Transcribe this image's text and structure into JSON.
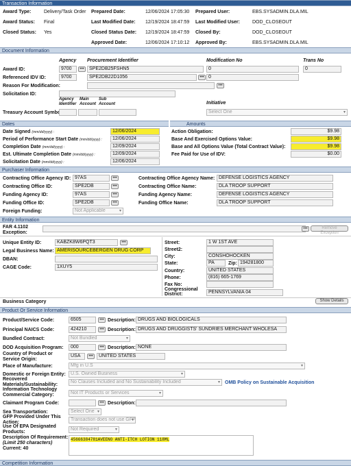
{
  "txn": {
    "header": "Transaction Information",
    "award_type_label": "Award Type:",
    "award_type": "Delivery/Task Order",
    "award_status_label": "Award Status:",
    "award_status": "Final",
    "closed_status_label": "Closed Status:",
    "closed_status": "Yes",
    "prepared_date_label": "Prepared Date:",
    "prepared_date": "12/06/2024 17:05:30",
    "last_mod_date_label": "Last Modified Date:",
    "last_mod_date": "12/19/2024 18:47:59",
    "closed_status_date_label": "Closed Status Date:",
    "closed_status_date": "12/19/2024 18:47:59",
    "approved_date_label": "Approved Date:",
    "approved_date": "12/06/2024 17:10:12",
    "prepared_user_label": "Prepared User:",
    "prepared_user": "EBS.SYSADMIN.DLA.MIL",
    "last_mod_user_label": "Last Modified User:",
    "last_mod_user": "DOD_CLOSEOUT",
    "closed_by_label": "Closed By:",
    "closed_by": "DOD_CLOSEOUT",
    "approved_by_label": "Approved By:",
    "approved_by": "EBS.SYSADMIN.DLA.MIL"
  },
  "doc": {
    "header": "Document Information",
    "col_agency": "Agency",
    "col_proc_id": "Procurement Identifier",
    "col_mod_no": "Modification No",
    "col_trans_no": "Trans No",
    "award_id_label": "Award ID:",
    "award_agency": "9700",
    "award_proc": "SPE2DB25FSHN5",
    "award_mod": "0",
    "award_trans": "0",
    "ref_idv_label": "Referenced IDV ID:",
    "ref_agency": "9700",
    "ref_proc": "SPE2DB22D1056",
    "ref_mod": "0",
    "reason_mod_label": "Reason For Modification:",
    "solicitation_label": "Solicitation ID:",
    "col_agency_id": "Agency Identifier",
    "col_main_acct": "Main Account",
    "col_sub_acct": "Sub Account",
    "col_initiative": "Initiative",
    "treasury_label": "Treasury Account Symbol:",
    "initiative_value": "Select One"
  },
  "dates": {
    "header": "Dates",
    "date_signed_label": "Date Signed",
    "date_signed": "12/06/2024",
    "pop_start_label": "Period of Performance Start Date",
    "pop_start": "12/06/2024",
    "completion_label": "Completion Date",
    "completion": "12/09/2024",
    "est_ult_label": "Est. Ultimate Completion Date",
    "est_ult": "12/09/2024",
    "solicitation_date_label": "Solicitation Date",
    "solicitation_date": "12/06/2024",
    "fmt": "(mm/dd/yyyy) :"
  },
  "amounts": {
    "header": "Amounts",
    "action_obl_label": "Action Obligation:",
    "action_obl": "$9.98",
    "base_exercised_label": "Base And Exercised Options Value:",
    "base_exercised": "$9.98",
    "base_all_label": "Base and All Options Value (Total Contract Value):",
    "base_all": "$9.98",
    "fee_label": "Fee Paid for Use of IDV:",
    "fee": "$0.00"
  },
  "purchaser": {
    "header": "Purchaser Information",
    "co_agency_id_label": "Contracting Office Agency ID:",
    "co_agency_id": "97AS",
    "co_id_label": "Contracting Office ID:",
    "co_id": "SPE2DB",
    "f_agency_id_label": "Funding Agency ID:",
    "f_agency_id": "97AS",
    "f_office_id_label": "Funding Office ID:",
    "f_office_id": "SPE2DB",
    "foreign_label": "Foreign Funding:",
    "foreign": "Not Applicable",
    "co_agency_name_label": "Contracting Office Agency Name:",
    "co_agency_name": "DEFENSE LOGISTICS AGENCY",
    "co_name_label": "Contracting Office Name:",
    "co_name": "DLA TROOP SUPPORT",
    "f_agency_name_label": "Funding Agency Name:",
    "f_agency_name": "DEFENSE LOGISTICS AGENCY",
    "f_office_name_label": "Funding Office Name:",
    "f_office_name": "DLA TROOP SUPPORT"
  },
  "entity": {
    "header": "Entity Information",
    "far_label": "FAR 4.1102 Exception:",
    "remove_btn": "Remove Exception",
    "uei_label": "Unique Entity ID:",
    "uei": "KABZK8W6PQT3",
    "legal_label": "Legal Business Name:",
    "legal": "AMERISOURCEBERGEN DRUG CORP",
    "dban_label": "DBAN:",
    "cage_label": "CAGE Code:",
    "cage": "1XUY5",
    "street_label": "Street:",
    "street": "1 W 1ST AVE",
    "street2_label": "Street2:",
    "city_label": "City:",
    "city": "CONSHOHOCKEN",
    "state_label": "State:",
    "state": "PA",
    "zip_label": "Zip:",
    "zip": "194281800",
    "country_label": "Country:",
    "country": "UNITED STATES",
    "phone_label": "Phone:",
    "phone": "(816) 665-1769",
    "fax_label": "Fax No:",
    "cong_label": "Congressional District:",
    "cong": "PENNSYLVANIA 04",
    "biz_cat_label": "Business Category",
    "show_details": "Show Details"
  },
  "product": {
    "header": "Product Or Service Information",
    "psc_label": "Product/Service Code:",
    "psc": "6505",
    "psc_desc_label": "Description:",
    "psc_desc": "DRUGS AND BIOLOGICALS",
    "naics_label": "Principal NAICS Code:",
    "naics": "424210",
    "naics_desc_label": "Description:",
    "naics_desc": "DRUGS AND DRUGGISTS' SUNDRIES MERCHANT WHOLESA",
    "bundled_label": "Bundled Contract:",
    "bundled": "Not Bundled",
    "dod_label": "DOD Acquisition Program:",
    "dod": "000",
    "dod_desc_label": "Description:",
    "dod_desc": "NONE",
    "origin_label": "Country of Product or Service Origin:",
    "origin_code": "USA",
    "origin_name": "UNITED STATES",
    "pom_label": "Place of Manufacture:",
    "pom": "Mfg in U.S",
    "dom_label": "Domestic or Foreign Entity:",
    "dom": "U.S. Owned Business",
    "recovered_label": "Recovered Materials/Sustainability:",
    "recovered": "No Clauses Included and No Sustainability Included",
    "omb_link": "OMB Policy on Sustainable Acquisition",
    "it_label": "Information Technology Commercial Category:",
    "it": "Not IT Products or Services",
    "claimant_label": "Claimant Program Code:",
    "claimant_desc_label": "Description:",
    "sea_label": "Sea Transportation:",
    "sea": "Select One",
    "gfp_label": "GFP Provided Under This Action:",
    "gfp": "Transaction does not use GFP",
    "epa_label": "Use Of EPA Designated Products:",
    "epa": "Not Required",
    "desc_req_label": "Description Of Requirement:",
    "desc_limit": "(Limit 250 characters)",
    "current": "Current: 40",
    "desc_req": "45666384781AVEENO ANTI-ITCH LOTION 118ML"
  },
  "competition": {
    "header": "Competition Information"
  }
}
